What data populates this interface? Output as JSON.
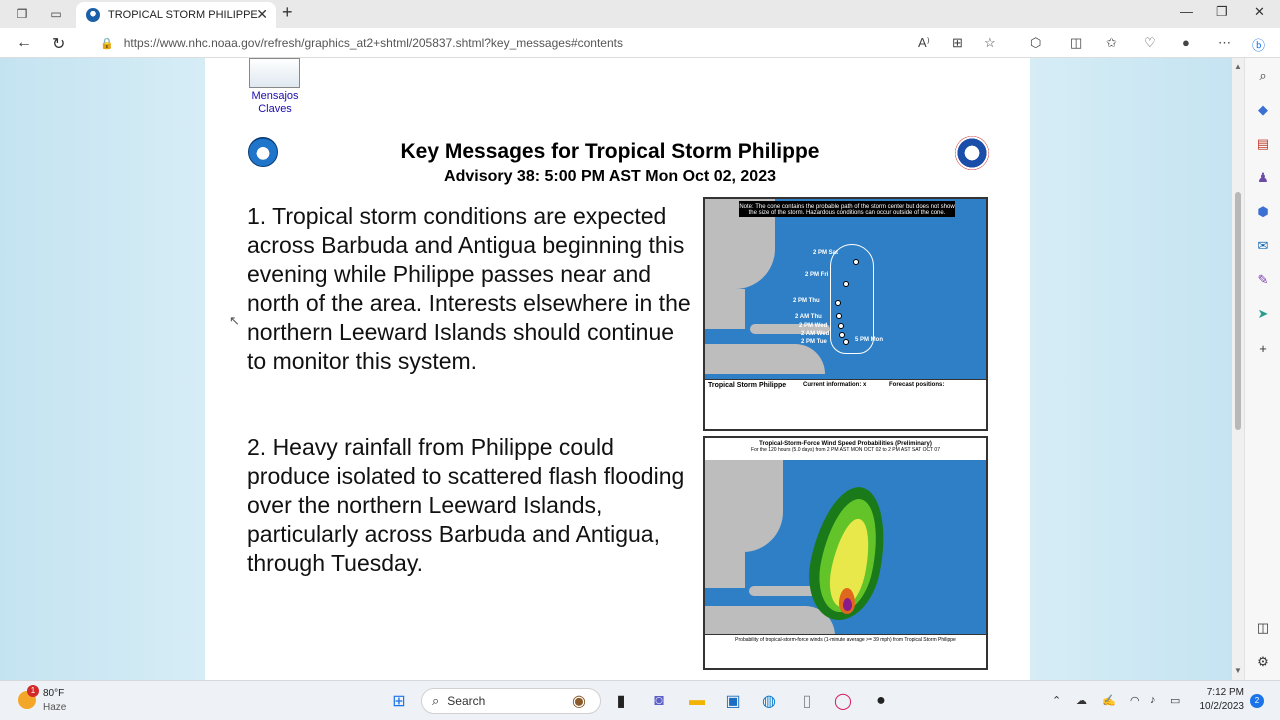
{
  "browser": {
    "tab_title": "TROPICAL STORM PHILIPPE",
    "url": "https://www.nhc.noaa.gov/refresh/graphics_at2+shtml/205837.shtml?key_messages#contents"
  },
  "page": {
    "thumb_label": "Mensajos Claves",
    "title": "Key Messages for Tropical Storm Philippe",
    "advisory": "Advisory 38:  5:00 PM AST Mon Oct 02, 2023",
    "message1": "1. Tropical storm conditions are expected across Barbuda and Antigua beginning this evening while Philippe passes near and north of the area. Interests elsewhere in the northern Leeward Islands should continue to monitor this system.",
    "message2": "2. Heavy rainfall from Philippe could produce isolated to scattered flash flooding over the northern Leeward Islands, particularly across Barbuda and Antigua, through Tuesday.",
    "map1": {
      "note": "Note: The cone contains the probable path of the storm center but does not show the size of the storm. Hazardous conditions can occur outside of the cone.",
      "labels": [
        "2 PM Sat",
        "2 PM Fri",
        "2 PM Thu",
        "2 AM Thu",
        "2 PM Wed",
        "2 AM Wed",
        "2 PM Tue",
        "5 PM Mon"
      ],
      "legend_title": "Tropical Storm Philippe",
      "legend_current": "Current information: x",
      "legend_forecast": "Forecast positions:"
    },
    "map2": {
      "title": "Tropical-Storm-Force Wind Speed Probabilities (Preliminary)",
      "subtitle": "For the 120 hours (5.0 days) from 2 PM AST MON OCT 02 to 2 PM AST SAT OCT 07",
      "legend": "Probability of tropical-storm-force winds (1-minute average >= 39 mph) from Tropical Storm Philippe"
    }
  },
  "taskbar": {
    "temp": "80°F",
    "weather": "Haze",
    "weather_badge": "1",
    "search": "Search",
    "time": "7:12 PM",
    "date": "10/2/2023",
    "notifications": "2"
  }
}
